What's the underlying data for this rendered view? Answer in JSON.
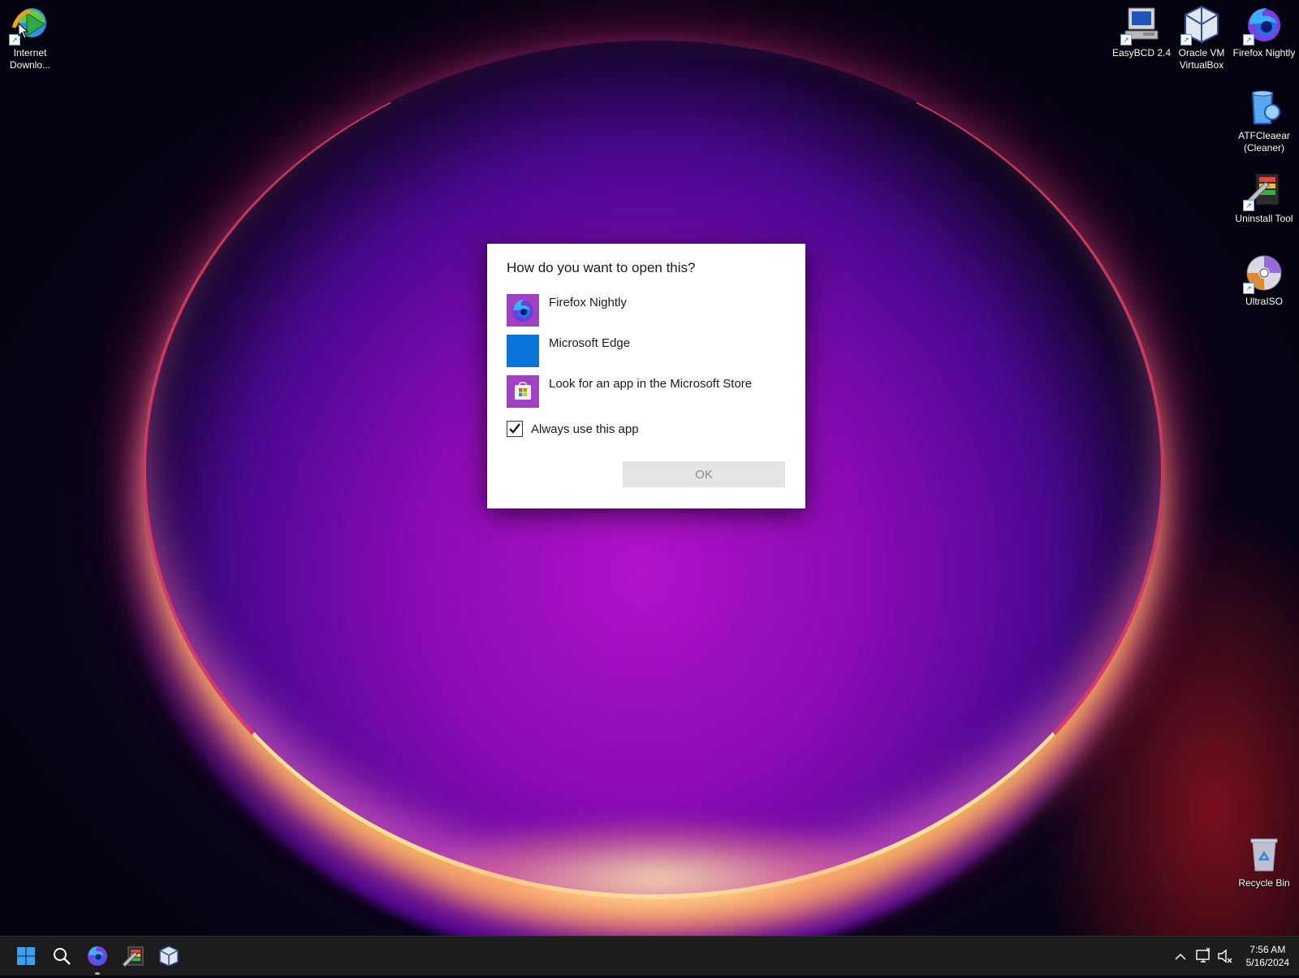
{
  "desktop": {
    "left_icons": [
      {
        "label": "Internet Downlo...",
        "icon": "internet-download-manager-icon"
      }
    ],
    "right_icons": [
      {
        "label": "EasyBCD 2.4",
        "icon": "easybcd-icon"
      },
      {
        "label": "Oracle VM VirtualBox",
        "icon": "virtualbox-icon"
      },
      {
        "label": "Firefox Nightly",
        "icon": "firefox-nightly-icon"
      },
      {
        "label": "ATFCleaear (Cleaner)",
        "icon": "atf-cleaner-icon"
      },
      {
        "label": "Uninstall Tool",
        "icon": "uninstall-tool-icon"
      },
      {
        "label": "UltraISO",
        "icon": "ultraiso-icon"
      },
      {
        "label": "Recycle Bin",
        "icon": "recycle-bin-icon"
      }
    ]
  },
  "dialog": {
    "title": "How do you want to open this?",
    "apps": [
      {
        "label": "Firefox Nightly",
        "icon": "firefox-nightly-icon"
      },
      {
        "label": "Microsoft Edge",
        "icon": "microsoft-edge-icon"
      },
      {
        "label": "Look for an app in the Microsoft Store",
        "icon": "microsoft-store-icon"
      }
    ],
    "always_use_label": "Always use this app",
    "always_use_checked": true,
    "ok_label": "OK",
    "ok_enabled": false
  },
  "taskbar": {
    "items": [
      "start-icon",
      "search-icon",
      "firefox-nightly-icon",
      "uninstall-tool-icon",
      "virtualbox-icon"
    ],
    "tray": {
      "time": "7:56 AM",
      "date": "5/16/2024"
    }
  },
  "colors": {
    "edge_blue": "#0a74da",
    "store_purple": "#a041c2",
    "taskbar_bg": "#1c1c1c"
  }
}
